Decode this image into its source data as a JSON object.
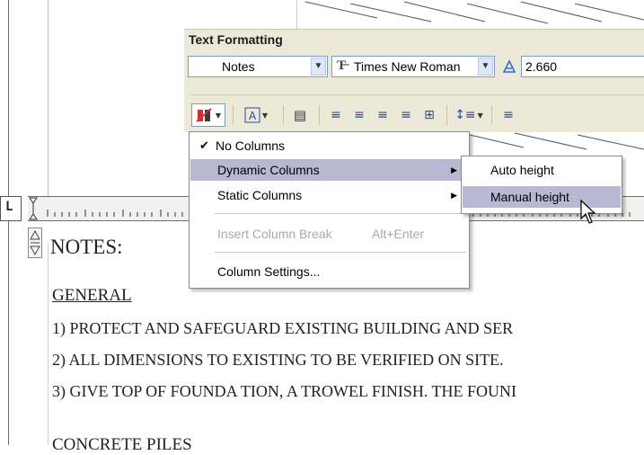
{
  "toolbar": {
    "title": "Text Formatting",
    "style_value": "Notes",
    "font_value": "Times New Roman",
    "height_value": "2.660"
  },
  "column_menu": {
    "items": [
      {
        "label": "No Columns",
        "checked": true
      },
      {
        "label": "Dynamic Columns",
        "submenu": true,
        "highlighted": true
      },
      {
        "label": "Static Columns",
        "submenu": true
      },
      {
        "label": "Insert Column Break",
        "shortcut": "Alt+Enter",
        "disabled": true
      },
      {
        "label": "Column Settings..."
      }
    ]
  },
  "dynamic_columns_submenu": {
    "items": [
      {
        "label": "Auto height"
      },
      {
        "label": "Manual height",
        "highlighted": true
      }
    ]
  },
  "drawing": {
    "heading": "NOTES:",
    "section": "GENERAL",
    "lines": [
      "1)  PROTECT AND SAFEGUARD EXISTING BUILDING AND SER",
      "2)  ALL DIMENSIONS TO EXISTING TO BE VERIFIED ON SITE.",
      "3)  GIVE TOP OF FOUNDA TION, A  TROWEL FINISH. THE FOUNI"
    ],
    "next_section": "CONCRETE PILES"
  },
  "colors": {
    "menu_highlight": "#b7b8d2",
    "toolbar_bg": "#ece9d8",
    "margin_line": "#e23b3b"
  }
}
